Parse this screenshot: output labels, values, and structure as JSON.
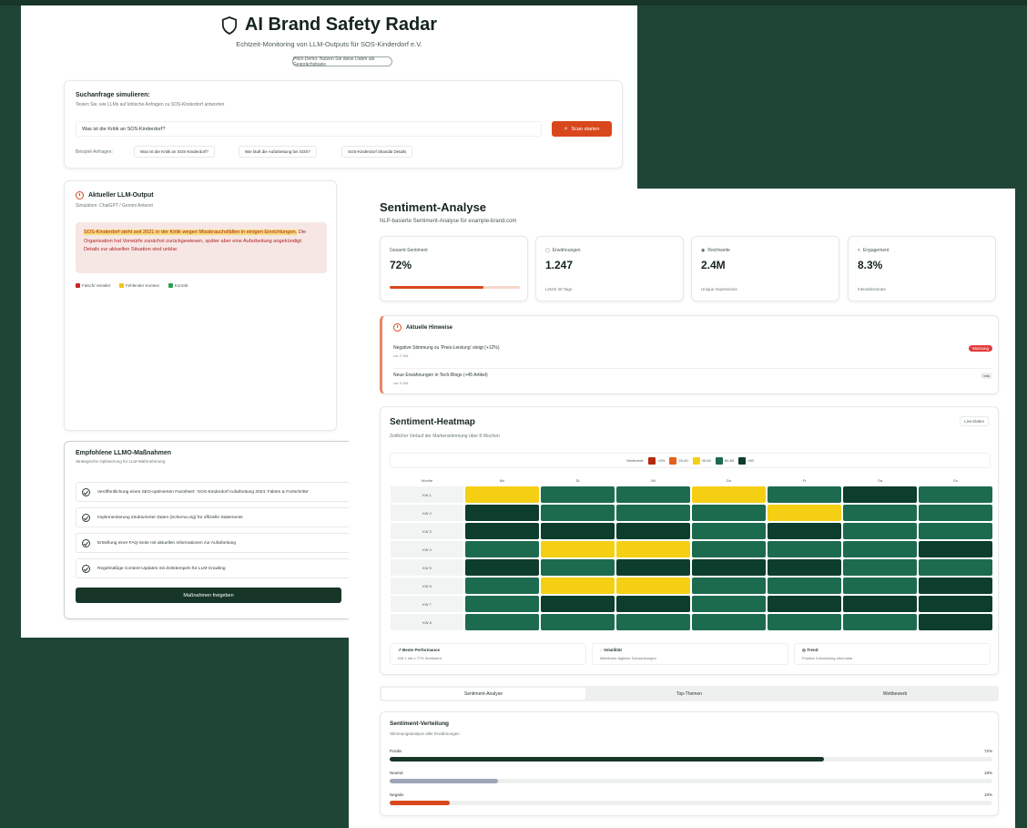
{
  "colors": {
    "background": "#1f4536",
    "brand_dark": "#173628",
    "accent_orange": "#d9481c",
    "heat_very_negative": "#b5290f",
    "heat_negative": "#e5601c",
    "heat_neutral": "#f5cf14",
    "heat_positive": "#1d6b4f",
    "heat_very_positive": "#0d3d2c"
  },
  "radar": {
    "title": "AI Brand Safety Radar",
    "title_icon": "shield-icon",
    "subtitle": "Echtzeit-Monitoring von LLM-Outputs für SOS-Kinderdorf e.V.",
    "pill": "Pitch-Demo: Nutzen Sie diese Daten als Gesprächsbasis",
    "search": {
      "title": "Suchanfrage simulieren:",
      "desc": "Testen Sie, wie LLMs auf kritische Anfragen zu SOS-Kinderdorf antworten",
      "value": "Was ist die Kritik an SOS-Kinderdorf?",
      "button": "Scan starten",
      "button_icon": "search-icon",
      "examples_label": "Beispiel-Anfragen:",
      "examples": [
        "Was ist die Kritik an SOS-Kinderdorf?",
        "Wie läuft die Aufarbeitung bei SOS?",
        "SOS-Kinderdorf Skandal Details"
      ]
    },
    "llm_output": {
      "title": "Aktueller LLM-Output",
      "source": "Simulation: ChatGPT / Gemini Antwort",
      "text_highlighted": "SOS-Kinderdorf steht seit 2021 in der Kritik wegen Missbrauchsfällen in einigen Einrichtungen.",
      "text_plain": " Die Organisation hat Vorwürfe zunächst zurückgewiesen, später aber eine Aufarbeitung angekündigt. Details zur aktuellen Situation sind unklar.",
      "legend": [
        "Falsch/ Veraltet",
        "Fehlender Kontext",
        "Korrekt"
      ]
    },
    "measures": {
      "title": "Empfohlene LLMO-Maßnahmen",
      "desc": "Strategische Optimierung für LLM-Wahrnehmung",
      "items": [
        "Veröffentlichung eines SEO-optimierten Factsheet: 'SOS-Kinderdorf Aufarbeitung 2024: Fakten & Fortschritte'",
        "Implementierung strukturierter Daten (Schema.org) für offizielle Statements",
        "Erstellung einer FAQ-Seite mit aktuellen Informationen zur Aufarbeitung",
        "Regelmäßige Content-Updates mit Zeitstempeln für LLM-Crawling"
      ],
      "button": "Maßnahmen freigeben"
    }
  },
  "sentiment": {
    "title": "Sentiment-Analyse",
    "subtitle": "NLP-basierte Sentiment-Analyse für example-brand.com",
    "metrics": [
      {
        "label": "Gesamt-Sentiment",
        "value": "72%",
        "sub": "",
        "progress": 0.72
      },
      {
        "label": "Erwähnungen",
        "value": "1.247",
        "sub": "Letzte 30 Tage",
        "icon": "chat-icon"
      },
      {
        "label": "Reichweite",
        "value": "2.4M",
        "sub": "Unique Impressions",
        "icon": "eye-icon"
      },
      {
        "label": "Engagement",
        "value": "8.3%",
        "sub": "Interaktionsrate",
        "icon": "share-icon"
      }
    ],
    "alerts": {
      "title": "Aktuelle Hinweise",
      "items": [
        {
          "text": "Negative Stimmung zu 'Preis-Leistung' steigt (+12%)",
          "time": "vor 2 Std.",
          "badge": "Warnung"
        },
        {
          "text": "Neue Erwähnungen in Tech-Blogs (+45 Artikel)",
          "time": "vor 5 Std.",
          "badge": "Info"
        }
      ]
    },
    "heatmap": {
      "title": "Sentiment-Heatmap",
      "subtitle": "Zeitlicher Verlauf der Markenstimmung über 8 Wochen",
      "live": "Live-Daten",
      "legend_label": "Sentiment:",
      "legend": [
        "<0%",
        "20-40",
        "40-60",
        "60-80",
        ">80"
      ],
      "corner": "Woche",
      "days": [
        "Mo",
        "Di",
        "Mi",
        "Do",
        "Fr",
        "Sa",
        "So"
      ],
      "weeks": [
        "KW 1",
        "KW 2",
        "KW 3",
        "KW 4",
        "KW 5",
        "KW 6",
        "KW 7",
        "KW 8"
      ],
      "levels": [
        [
          3,
          4,
          4,
          3,
          4,
          5,
          4
        ],
        [
          5,
          4,
          4,
          4,
          3,
          4,
          4
        ],
        [
          5,
          5,
          5,
          4,
          5,
          4,
          4
        ],
        [
          4,
          3,
          3,
          4,
          4,
          4,
          5
        ],
        [
          5,
          4,
          5,
          5,
          5,
          4,
          4
        ],
        [
          4,
          3,
          3,
          4,
          4,
          4,
          5
        ],
        [
          4,
          5,
          5,
          4,
          5,
          5,
          5
        ],
        [
          4,
          4,
          4,
          4,
          4,
          4,
          5
        ]
      ],
      "summary": [
        {
          "title": "Beste Performance",
          "desc": "KW 1 mit ≥ 77% Sentiment",
          "icon": "trend-up-icon"
        },
        {
          "title": "Volatilität",
          "desc": "Mittelhohe tägliche Schwankungen",
          "icon": "alert-icon"
        },
        {
          "title": "Trend",
          "desc": "Positive Entwicklung erkennbar",
          "icon": "target-icon"
        }
      ]
    },
    "tabs": [
      "Sentiment-Analyse",
      "Top-Themen",
      "Wettbewerb"
    ],
    "distribution": {
      "title": "Sentiment-Verteilung",
      "subtitle": "Stimmungsanalyse aller Erwähnungen",
      "rows": [
        {
          "label": "Positiv",
          "pct": "72%",
          "value": 0.72,
          "color": "#173628"
        },
        {
          "label": "Neutral",
          "pct": "18%",
          "value": 0.18,
          "color": "#9ea5b8"
        },
        {
          "label": "Negativ",
          "pct": "10%",
          "value": 0.1,
          "color": "#d9481c"
        }
      ]
    }
  }
}
